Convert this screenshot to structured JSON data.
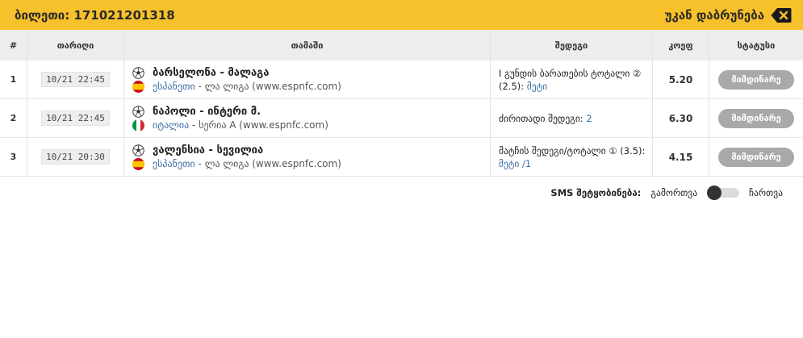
{
  "header": {
    "ticket_label": "ბილეთი: 171021201318",
    "back_label": "უკან დაბრუნება",
    "back_icon": "backspace-icon",
    "bg_color": "#f7c12b"
  },
  "table": {
    "columns": [
      "#",
      "თარიღი",
      "თამაში",
      "შედეგი",
      "კოეფ",
      "სტატუსი"
    ],
    "rows": [
      {
        "num": "1",
        "date": "10/21 22:45",
        "game": "ბარსელონა - მალაგა",
        "country": "ესპანეთი",
        "league": " - ლა ლიგა (www.espnfc.com)",
        "flag": "spain",
        "result_text": "I გუნდის ბარათების ტოტალი ② (2.5): ",
        "result_value": "მეტი",
        "coef": "5.20",
        "status": "მიმდინარე"
      },
      {
        "num": "2",
        "date": "10/21 22:45",
        "game": "ნაპოლი - ინტერი მ.",
        "country": "იტალია",
        "league": " - სერია A (www.espnfc.com)",
        "flag": "italy",
        "result_text": "ძირითადი შედეგი: ",
        "result_value": "2",
        "coef": "6.30",
        "status": "მიმდინარე"
      },
      {
        "num": "3",
        "date": "10/21 20:30",
        "game": "ვალენსია - სევილია",
        "country": "ესპანეთი",
        "league": " - ლა ლიგა (www.espnfc.com)",
        "flag": "spain",
        "result_text": "მატჩის შედეგი/ტოტალი ① (3.5): ",
        "result_value": "მეტი /1",
        "coef": "4.15",
        "status": "მიმდინარე"
      }
    ]
  },
  "sms": {
    "label": "SMS შეტყობინება:",
    "off_label": "გამორთვა",
    "on_label": "ჩართვა",
    "state": "off"
  }
}
